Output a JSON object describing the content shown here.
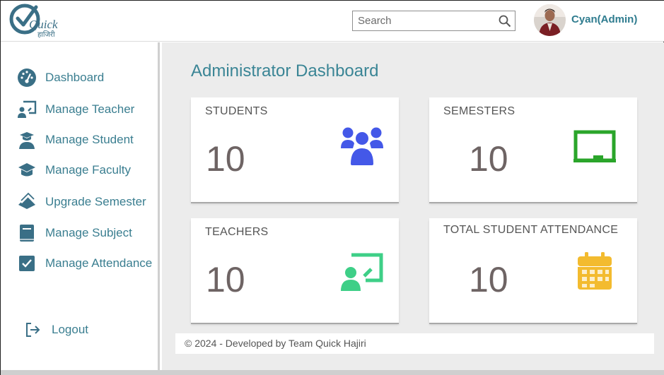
{
  "app": {
    "logo_text": "Quick",
    "logo_subtext": "हाजिरी"
  },
  "header": {
    "search_placeholder": "Search",
    "user_name": "Cyan(Admin)"
  },
  "sidebar": {
    "items": [
      {
        "label": "Dashboard",
        "icon": "dashboard-gauge-icon"
      },
      {
        "label": "Manage Teacher",
        "icon": "teacher-icon"
      },
      {
        "label": "Manage Student",
        "icon": "graduate-icon"
      },
      {
        "label": "Manage Faculty",
        "icon": "faculty-cap-icon"
      },
      {
        "label": "Upgrade Semester",
        "icon": "layers-icon"
      },
      {
        "label": "Manage Subject",
        "icon": "book-icon"
      },
      {
        "label": "Manage Attendance",
        "icon": "checkbox-icon"
      }
    ],
    "logout_label": "Logout"
  },
  "main": {
    "title": "Administrator Dashboard",
    "cards": [
      {
        "label": "STUDENTS",
        "value": "10",
        "icon": "users-icon",
        "color": "#4458e8"
      },
      {
        "label": "SEMESTERS",
        "value": "10",
        "icon": "chalkboard-icon",
        "color": "#2aa52a"
      },
      {
        "label": "TEACHERS",
        "value": "10",
        "icon": "teacher-board-icon",
        "color": "#3ecf87"
      },
      {
        "label": "TOTAL STUDENT ATTENDANCE",
        "value": "10",
        "icon": "calendar-icon",
        "color": "#f3bb2f"
      }
    ],
    "footer": "© 2024 - Developed by Team Quick Hajiri"
  },
  "colors": {
    "accent": "#3a7e90",
    "main_bg": "#ececec"
  }
}
